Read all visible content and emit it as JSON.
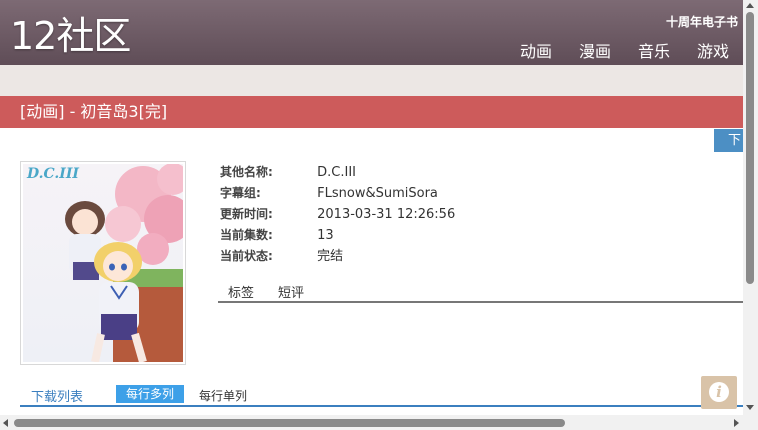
{
  "header": {
    "logo": "12社区",
    "tagline": "十周年电子书",
    "nav": [
      "动画",
      "漫画",
      "音乐",
      "游戏"
    ]
  },
  "titlebar": {
    "title": "[动画] - 初音岛3[完]"
  },
  "download_button": {
    "label": "下"
  },
  "poster": {
    "logo_text": "D.C.III"
  },
  "info": {
    "rows": [
      {
        "key": "其他名称:",
        "value": "D.C.III"
      },
      {
        "key": "字幕组:",
        "value": "FLsnow&SumiSora"
      },
      {
        "key": "更新时间:",
        "value": "2013-03-31 12:26:56"
      },
      {
        "key": "当前集数:",
        "value": "13"
      },
      {
        "key": "当前状态:",
        "value": "完结"
      }
    ]
  },
  "subtabs": {
    "tags": "标签",
    "review": "短评"
  },
  "download_list": {
    "label": "下载列表",
    "view_multi": "每行多列",
    "view_single": "每行单列"
  },
  "info_button": {
    "icon": "info-icon",
    "glyph": "i"
  },
  "colors": {
    "header": "#6e5c66",
    "titlebar": "#cd5b5b",
    "accent_blue": "#3da0e8",
    "link_blue": "#3b7fbf"
  }
}
